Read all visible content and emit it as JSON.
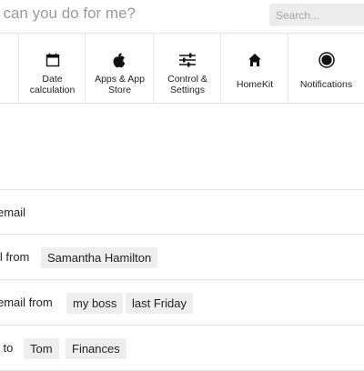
{
  "header": {
    "question": "t can you do for me?",
    "search_placeholder": "Search..."
  },
  "categories": [
    {
      "label": "Date\ncalculation",
      "icon": "calendar-icon"
    },
    {
      "label": "Apps & App\nStore",
      "icon": "apple-icon"
    },
    {
      "label": "Control &\nSettings",
      "icon": "sliders-icon"
    },
    {
      "label": "HomeKit",
      "icon": "home-icon"
    },
    {
      "label": "Notifications",
      "icon": "notifications-icon"
    }
  ],
  "suggestions": [
    {
      "prefix": "email",
      "chips": []
    },
    {
      "prefix": "il from",
      "chips": [
        "Samantha Hamilton"
      ]
    },
    {
      "prefix": "email from",
      "chips": [
        "my boss",
        "last Friday"
      ]
    },
    {
      "prefix": "l to",
      "chips": [
        "Tom",
        "Finances"
      ]
    }
  ]
}
